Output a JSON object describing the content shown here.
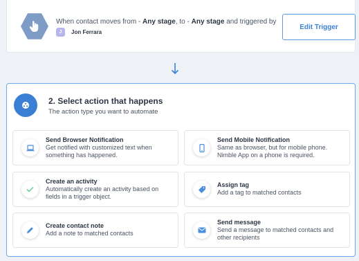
{
  "trigger": {
    "text_prefix": "When contact moves from - ",
    "from_stage": "Any stage",
    "text_mid": ", to - ",
    "to_stage": "Any stage",
    "text_suffix": " and triggered by",
    "user_initial": "J",
    "user_name": "Jon Ferrara",
    "edit_label": "Edit Trigger"
  },
  "step": {
    "title": "2. Select action that happens",
    "subtitle": "The action type you want to automate"
  },
  "options": [
    {
      "title": "Send Browser Notification",
      "desc": "Get notified with customized text when something has happened.",
      "icon": "laptop-icon"
    },
    {
      "title": "Send Mobile Notification",
      "desc": "Same as browser, but for mobile phone. Nimble App on a phone is required.",
      "icon": "mobile-icon"
    },
    {
      "title": "Create an activity",
      "desc": "Automatically create an activity based on fields in a trigger object.",
      "icon": "check-icon"
    },
    {
      "title": "Assign tag",
      "desc": "Add a tag to matched contacts",
      "icon": "tag-icon"
    },
    {
      "title": "Create contact note",
      "desc": "Add a note to matched contacts",
      "icon": "pencil-icon"
    },
    {
      "title": "Send message",
      "desc": "Send a message to matched contacts and other recipients",
      "icon": "envelope-icon"
    }
  ],
  "colors": {
    "accent": "#3a7fd3",
    "icon_blue": "#4a8ee0",
    "icon_green": "#5cc98c",
    "panel_border": "#6ba8ec"
  }
}
